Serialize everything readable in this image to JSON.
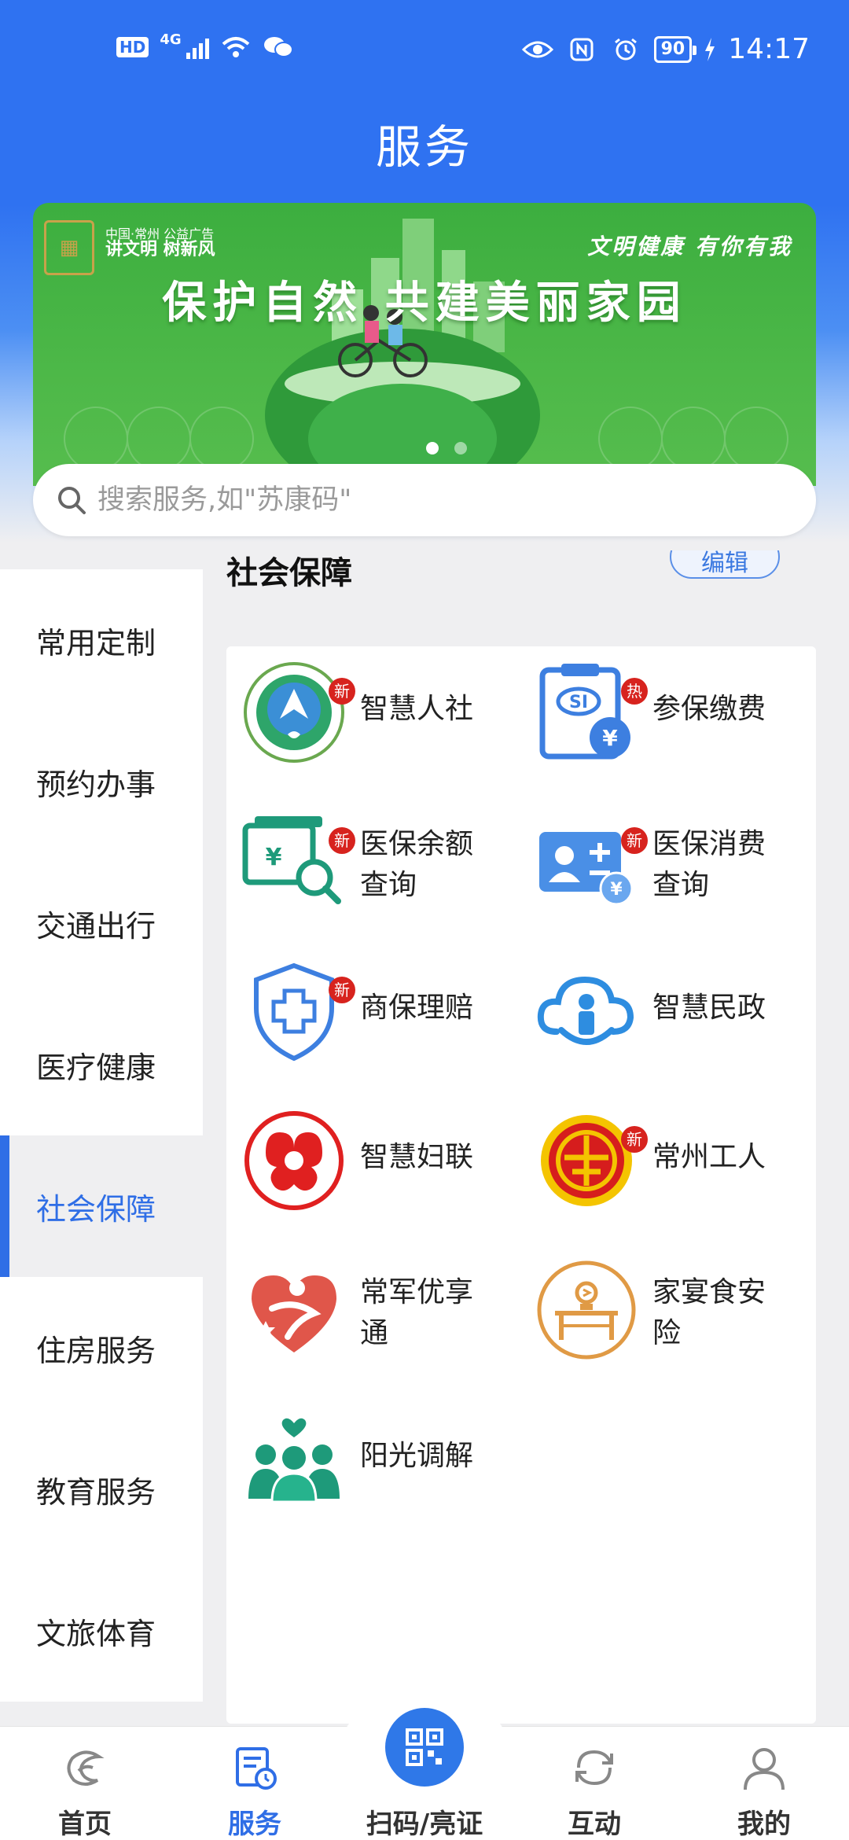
{
  "status_bar": {
    "hd_label": "HD",
    "network": "4G",
    "battery": "90",
    "time": "14:17"
  },
  "header": {
    "title": "服务"
  },
  "banner": {
    "org_line": "中国·常州 公益广告",
    "org_slogan": "讲文明 树新风",
    "top_right": "文明健康 有你有我",
    "slogan": "保护自然 共建美丽家园",
    "dots": 2,
    "active_dot": 0
  },
  "search": {
    "placeholder": "搜索服务,如\"苏康码\""
  },
  "sidebar": {
    "items": [
      {
        "label": "常用定制"
      },
      {
        "label": "预约办事"
      },
      {
        "label": "交通出行"
      },
      {
        "label": "医疗健康"
      },
      {
        "label": "社会保障",
        "active": true
      },
      {
        "label": "住房服务"
      },
      {
        "label": "教育服务"
      },
      {
        "label": "文旅体育"
      }
    ]
  },
  "section": {
    "title": "社会保障",
    "edit_label": "编辑"
  },
  "services": [
    {
      "label": "智慧人社",
      "badge": "新",
      "icon": "hrss-logo-icon"
    },
    {
      "label": "参保缴费",
      "badge": "热",
      "icon": "si-payment-icon"
    },
    {
      "label": "医保余额查询",
      "line1": "医保余额",
      "line2": "查询",
      "badge": "新",
      "icon": "balance-search-icon"
    },
    {
      "label": "医保消费查询",
      "line1": "医保消费",
      "line2": "查询",
      "badge": "新",
      "icon": "consumption-card-icon"
    },
    {
      "label": "商保理赔",
      "badge": "新",
      "icon": "insurance-shield-icon"
    },
    {
      "label": "智慧民政",
      "badge": "",
      "icon": "civil-affairs-cloud-icon"
    },
    {
      "label": "智慧妇联",
      "badge": "",
      "icon": "womens-federation-icon"
    },
    {
      "label": "常州工人",
      "badge": "新",
      "icon": "trade-union-icon"
    },
    {
      "label": "常军优享通",
      "line1": "常军优享",
      "line2": "通",
      "badge": "",
      "icon": "military-heart-icon"
    },
    {
      "label": "家宴食安险",
      "line1": "家宴食安",
      "line2": "险",
      "badge": "",
      "icon": "banquet-table-icon"
    },
    {
      "label": "阳光调解",
      "badge": "",
      "icon": "mediation-people-icon"
    }
  ],
  "bottom_nav": [
    {
      "label": "首页",
      "icon": "home-swirl-icon"
    },
    {
      "label": "服务",
      "icon": "service-doc-icon",
      "active": true
    },
    {
      "label": "扫码/亮证",
      "icon": "qr-scan-icon"
    },
    {
      "label": "互动",
      "icon": "refresh-interact-icon"
    },
    {
      "label": "我的",
      "icon": "profile-icon"
    }
  ],
  "colors": {
    "primary": "#2f72f1",
    "active_text": "#2f6ee6",
    "badge_red": "#d7231e",
    "banner_green": "#4db848"
  }
}
